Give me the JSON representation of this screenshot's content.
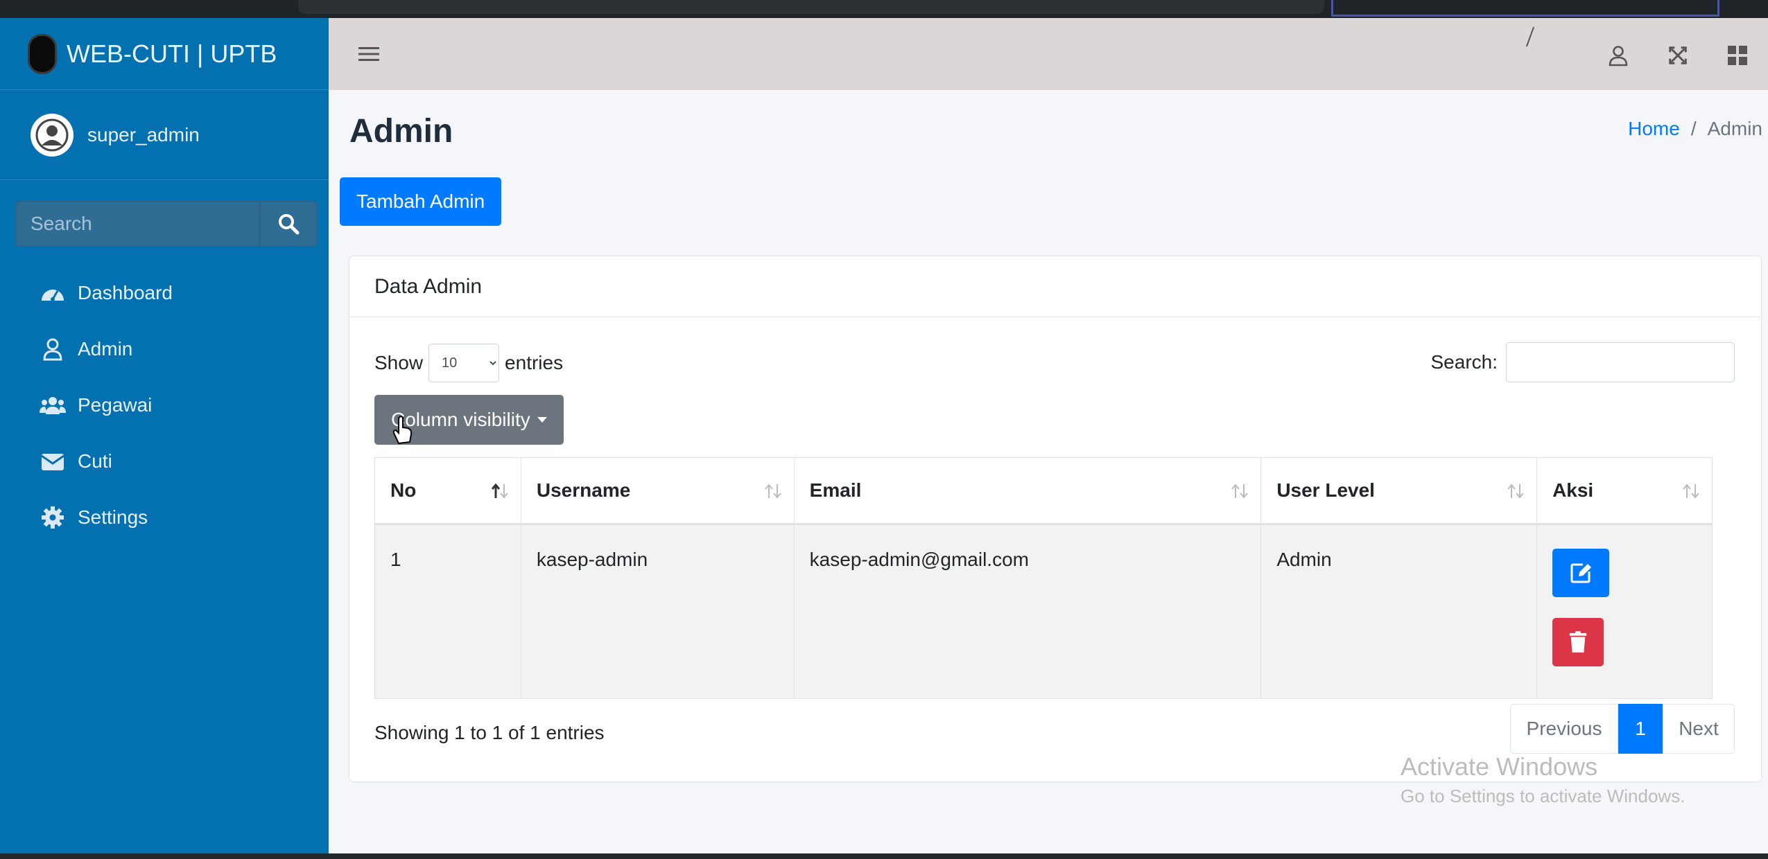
{
  "brand": {
    "title": "WEB-CUTI | UPTB"
  },
  "user": {
    "name": "super_admin"
  },
  "sidebar_search": {
    "placeholder": "Search"
  },
  "nav": {
    "items": [
      {
        "label": "Dashboard",
        "icon": "tachometer-icon"
      },
      {
        "label": "Admin",
        "icon": "user-icon"
      },
      {
        "label": "Pegawai",
        "icon": "users-icon"
      },
      {
        "label": "Cuti",
        "icon": "envelope-icon"
      },
      {
        "label": "Settings",
        "icon": "gear-icon"
      }
    ]
  },
  "page": {
    "title": "Admin"
  },
  "breadcrumb": {
    "home": "Home",
    "sep": "/",
    "current": "Admin"
  },
  "actions": {
    "add_label": "Tambah Admin"
  },
  "card": {
    "title": "Data Admin"
  },
  "datatable": {
    "show_label": "Show",
    "entries_label": "entries",
    "page_length": "10",
    "search_label": "Search:",
    "colvis_label": "Column visibility",
    "columns": [
      "No",
      "Username",
      "Email",
      "User Level",
      "Aksi"
    ],
    "rows": [
      {
        "no": "1",
        "username": "kasep-admin",
        "email": "kasep-admin@gmail.com",
        "level": "Admin"
      }
    ],
    "info": "Showing 1 to 1 of 1 entries",
    "pagination": {
      "previous": "Previous",
      "current": "1",
      "next": "Next"
    }
  },
  "watermark": {
    "line1": "Activate Windows",
    "line2": "Go to Settings to activate Windows."
  },
  "colors": {
    "sidebar": "#0370b0",
    "primary": "#007bff",
    "danger": "#dc3545",
    "secondary": "#6c757d"
  }
}
